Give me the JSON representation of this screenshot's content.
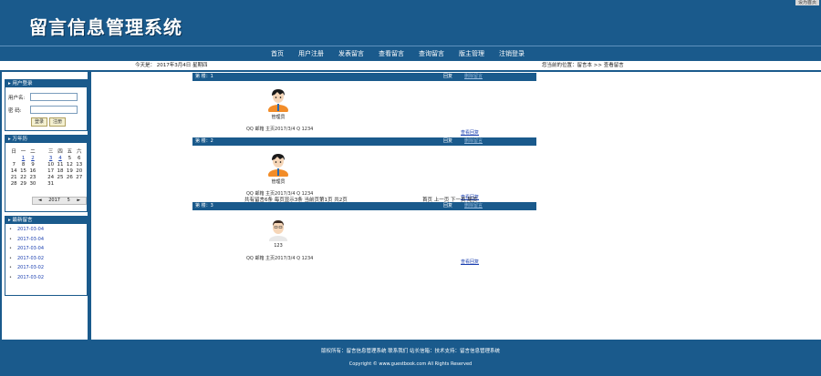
{
  "header": {
    "title": "留言信息管理系统",
    "top_right": "设为首页"
  },
  "nav": {
    "items": [
      "首页",
      "用户注册",
      "发表留言",
      "查看留言",
      "查询留言",
      "版主管理",
      "注销登录"
    ]
  },
  "infobar": {
    "date": "今天是：   2017年3月4日   星期四",
    "position": "您当前的位置：留言本 >> 查看留言"
  },
  "login": {
    "title": "用户登录",
    "username_label": "用户名:",
    "password_label": "密  码:",
    "username_value": "",
    "password_value": "",
    "login_button": "登录",
    "register_button": "注册"
  },
  "calendar": {
    "title": "万年历",
    "headers": [
      "日",
      "一",
      "二",
      "三",
      "四",
      "五",
      "六"
    ],
    "rows": [
      [
        "",
        "1",
        "2",
        "",
        "3",
        "4",
        "5",
        "6"
      ],
      [
        "7",
        "8",
        "9",
        "",
        "10",
        "11",
        "12",
        "13"
      ],
      [
        "14",
        "15",
        "16",
        "",
        "17",
        "18",
        "19",
        "20"
      ],
      [
        "21",
        "22",
        "23",
        "",
        "24",
        "25",
        "26",
        "27"
      ],
      [
        "28",
        "29",
        "30",
        "",
        "31",
        "",
        "",
        ""
      ]
    ],
    "prev": "◄",
    "year": "2017",
    "month": "5",
    "next": "►"
  },
  "recent": {
    "title": "最新留言",
    "items": [
      "2017-03-04",
      "2017-03-04",
      "2017-03-04",
      "2017-03-02",
      "2017-03-02",
      "2017-03-02"
    ]
  },
  "messages": [
    {
      "header_left": "第 楼：1",
      "action1": "回复",
      "action2": "删除留言",
      "username": "管理员",
      "meta": "QQ  邮箱  主页2017/3/4  Q 1234",
      "view_link": "查看回复"
    },
    {
      "header_left": "第 楼：2",
      "action1": "回复",
      "action2": "删除留言",
      "username": "管理员",
      "meta": "QQ  邮箱  主页2017/3/4  Q 1234",
      "view_link": "查看回复"
    },
    {
      "header_left": "第 楼：3",
      "action1": "回复",
      "action2": "删除留言",
      "username": "123",
      "meta": "QQ  邮箱  主页2017/3/4  Q 1234",
      "view_link": "查看回复"
    }
  ],
  "pager": {
    "summary": "共有留言6条 每页显示3条  当前页第1页 共2页",
    "nav": "首页  上一页  下一页  尾页"
  },
  "footer": {
    "line1": "版权所有：留言信息管理系统 联系我们 站长信箱：技术支持：留言信息管理系统",
    "line2": "Copyright © www.guestbook.com All Rights Reserved"
  },
  "colors": {
    "primary": "#1a5a8c",
    "link": "#1a3fb0",
    "shirt": "#f28c28",
    "avatar_hair": "#1a1a1a"
  }
}
